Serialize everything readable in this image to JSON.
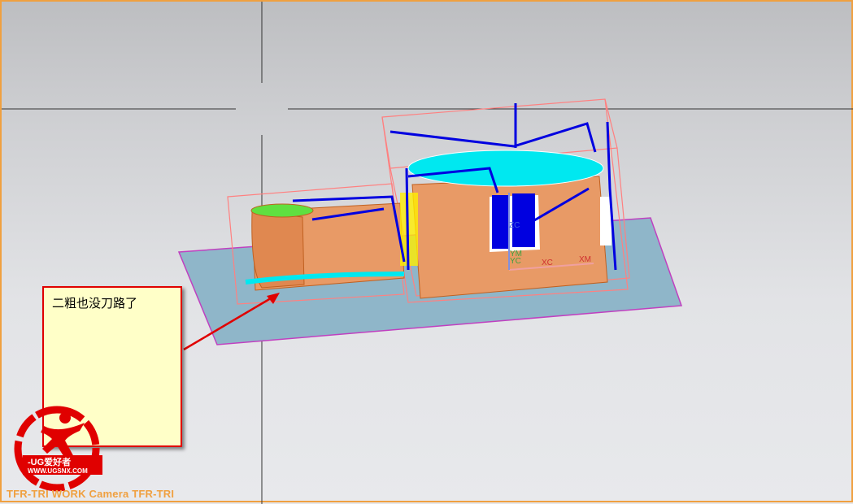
{
  "viewport": {
    "status_text": "TFR-TRI WORK Camera TFR-TRI",
    "note_text": "二粗也没刀路了",
    "axis_labels": {
      "zc": "ZC",
      "ym": "YM",
      "yc": "YC",
      "xc": "XC",
      "xm": "XM"
    },
    "watermark": {
      "brand": "UG爱好者",
      "url": "WWW.UGSNX.COM"
    },
    "colors": {
      "part": "#e89a66",
      "toolpath": "#0000e0",
      "cyan": "#00e8f0",
      "plane": "#8fb6c9",
      "note_border": "#e00000",
      "status": "#f0a040"
    }
  }
}
